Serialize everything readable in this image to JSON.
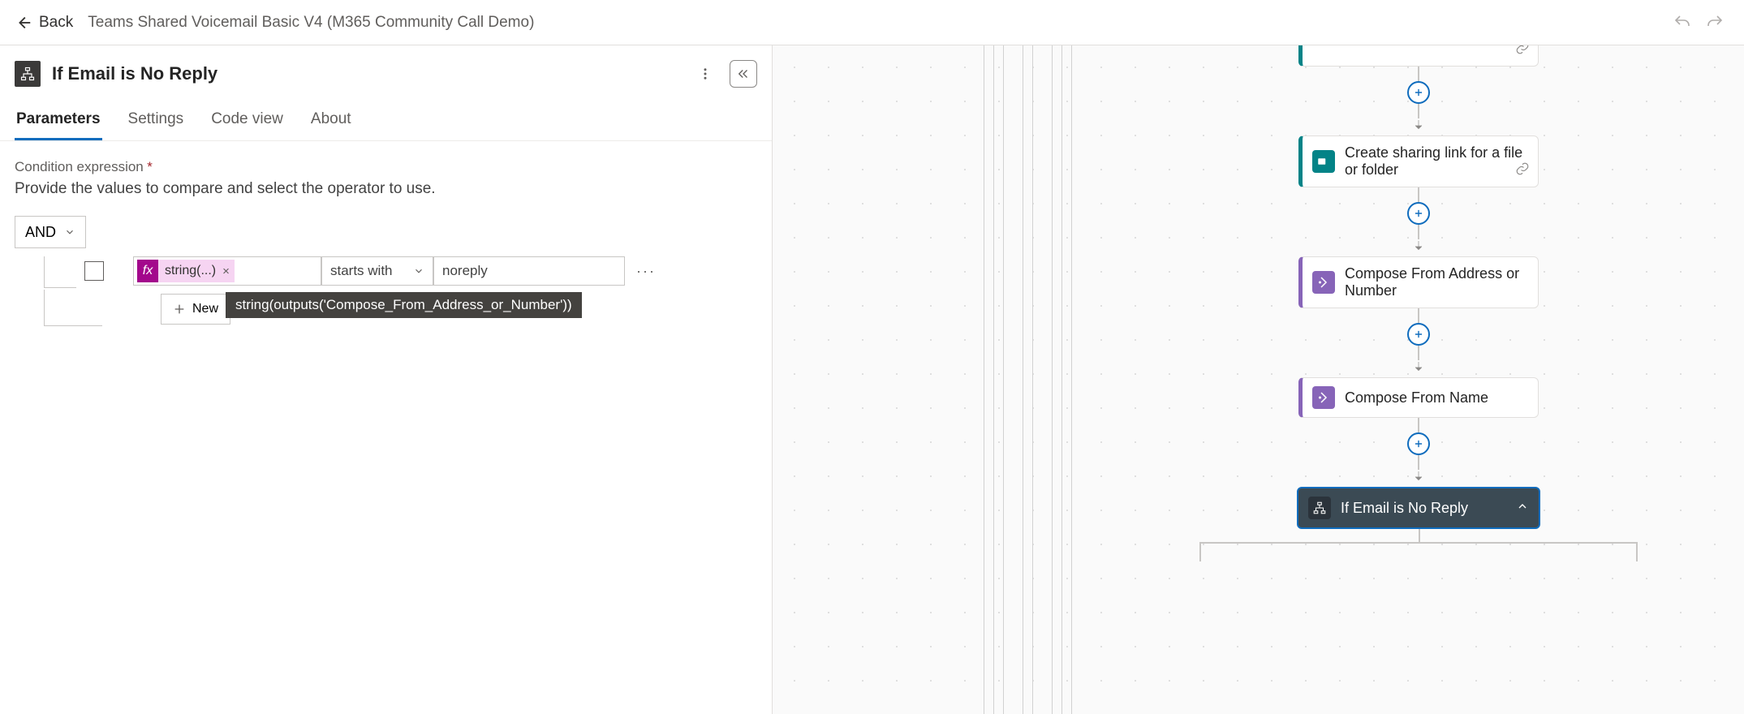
{
  "header": {
    "back_label": "Back",
    "flow_title": "Teams Shared Voicemail Basic V4 (M365 Community Call Demo)"
  },
  "panel": {
    "node_title": "If Email is No Reply",
    "tabs": [
      "Parameters",
      "Settings",
      "Code view",
      "About"
    ],
    "active_tab": 0,
    "field_label": "Condition expression",
    "field_required": "*",
    "field_help": "Provide the values to compare and select the operator to use.",
    "group_operator": "AND",
    "condition": {
      "left_token": "string(...)",
      "operator": "starts with",
      "right_value": "noreply"
    },
    "tooltip": "string(outputs('Compose_From_Address_or_Number'))",
    "new_item_label": "New",
    "more": "···"
  },
  "canvas": {
    "nodes": {
      "sharing_link": "Create sharing link for a file or folder",
      "compose_from": "Compose From Address or Number",
      "compose_name": "Compose From Name",
      "if_no_reply": "If Email is No Reply"
    }
  }
}
